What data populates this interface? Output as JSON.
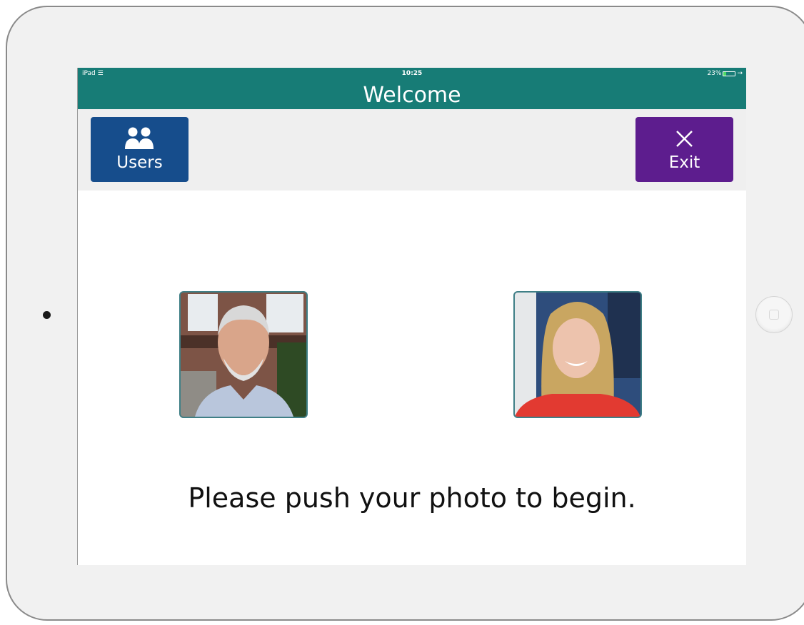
{
  "status_bar": {
    "device": "iPad",
    "time": "10:25",
    "battery_percent": "23%",
    "battery_level": 0.23
  },
  "header": {
    "title": "Welcome"
  },
  "toolbar": {
    "users_label": "Users",
    "users_icon": "users-icon",
    "exit_label": "Exit",
    "exit_icon": "close-icon",
    "users_color": "#164d8c",
    "exit_color": "#5d1d8e"
  },
  "colors": {
    "title_bar": "#177c76",
    "toolbar": "#efefef"
  },
  "users": [
    {
      "photo": "photo of older man with white beard"
    },
    {
      "photo": "photo of smiling woman with blonde hair"
    }
  ],
  "main": {
    "prompt": "Please push your photo to begin."
  }
}
